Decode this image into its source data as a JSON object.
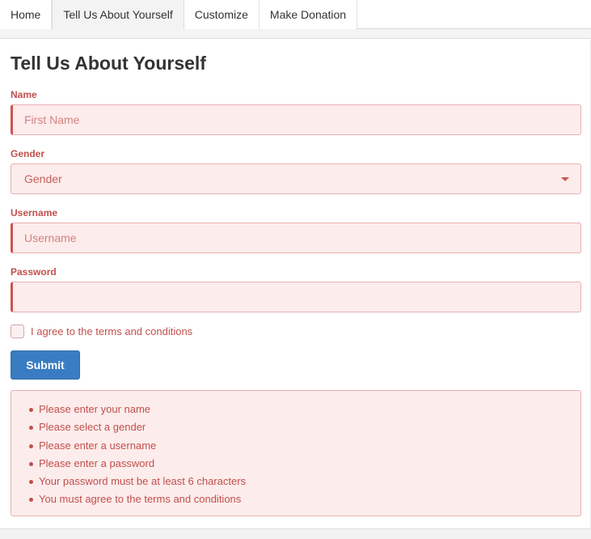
{
  "nav": {
    "tabs": [
      {
        "label": "Home",
        "active": false
      },
      {
        "label": "Tell Us About Yourself",
        "active": true
      },
      {
        "label": "Customize",
        "active": false
      },
      {
        "label": "Make Donation",
        "active": false
      }
    ]
  },
  "form": {
    "title": "Tell Us About Yourself",
    "name": {
      "label": "Name",
      "placeholder": "First Name",
      "value": ""
    },
    "gender": {
      "label": "Gender",
      "selected": "Gender"
    },
    "username": {
      "label": "Username",
      "placeholder": "Username",
      "value": ""
    },
    "password": {
      "label": "Password",
      "placeholder": "",
      "value": ""
    },
    "terms": {
      "label": "I agree to the terms and conditions",
      "checked": false
    },
    "submit_label": "Submit"
  },
  "errors": [
    "Please enter your name",
    "Please select a gender",
    "Please enter a username",
    "Please enter a password",
    "Your password must be at least 6 characters",
    "You must agree to the terms and conditions"
  ],
  "colors": {
    "error_text": "#c0504d",
    "error_bg": "#fdecec",
    "error_border": "#e8b1b1",
    "primary_button": "#3a7cc2"
  }
}
